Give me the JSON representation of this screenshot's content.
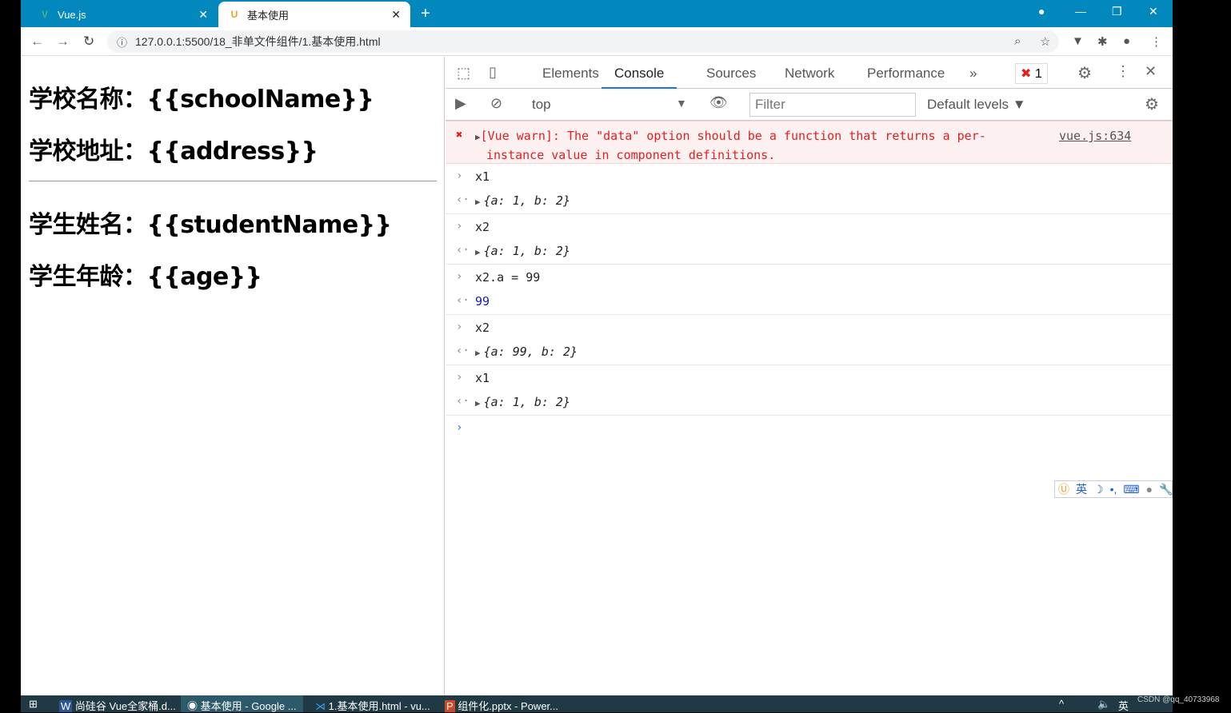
{
  "browser": {
    "tabs": [
      {
        "title": "Vue.js",
        "icon": "vue-logo-icon"
      },
      {
        "title": "基本使用",
        "icon": "live-server-icon"
      }
    ],
    "url": "127.0.0.1:5500/18_非单文件组件/1.基本使用.html"
  },
  "page": {
    "lines": [
      "学校名称：{{schoolName}}",
      "学校地址：{{address}}",
      "学生姓名：{{studentName}}",
      "学生年龄：{{age}}"
    ]
  },
  "devtools": {
    "tabs": [
      "Elements",
      "Console",
      "Sources",
      "Network",
      "Performance"
    ],
    "active_tab": "Console",
    "error_count": "1",
    "context": "top",
    "filter_placeholder": "Filter",
    "levels": "Default levels ▼",
    "error": {
      "text": "[Vue warn]: The \"data\" option should be a function that returns a per-instance value in component definitions.",
      "source": "vue.js:634"
    },
    "entries": [
      {
        "input": "x1",
        "output": "{a: 1, b: 2}"
      },
      {
        "input": "x2",
        "output": "{a: 1, b: 2}"
      },
      {
        "input": "x2.a = 99",
        "output": "99"
      },
      {
        "input": "x2",
        "output": "{a: 99, b: 2}"
      },
      {
        "input": "x1",
        "output": "{a: 1, b: 2}"
      }
    ]
  },
  "ime": {
    "lang": "英"
  },
  "taskbar": {
    "items": [
      "尚硅谷 Vue全家桶.d...",
      "基本使用 - Google ...",
      "1.基本使用.html - vu...",
      "组件化.pptx - Power..."
    ],
    "lang": "英",
    "watermark": "CSDN @qq_40733968"
  }
}
